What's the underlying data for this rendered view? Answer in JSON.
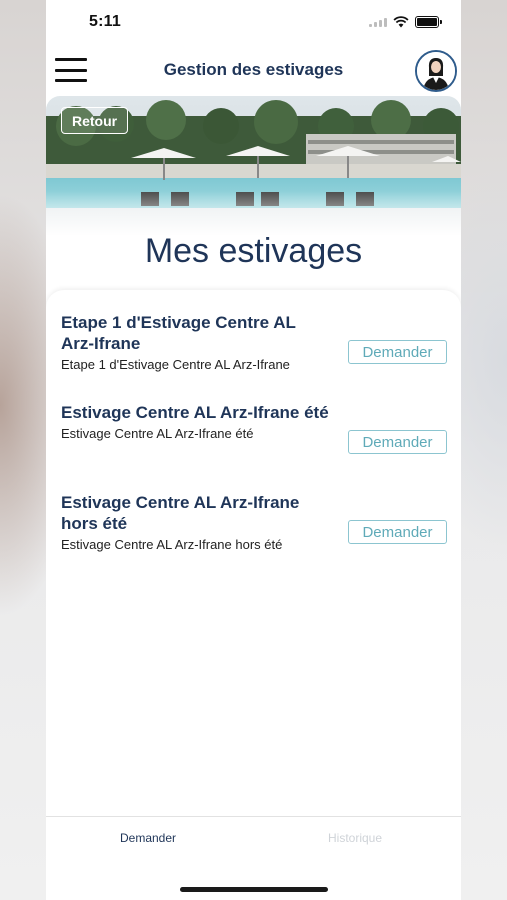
{
  "status": {
    "time": "5:11"
  },
  "header": {
    "title": "Gestion des estivages"
  },
  "hero": {
    "back_label": "Retour"
  },
  "page": {
    "title": "Mes estivages"
  },
  "items": [
    {
      "title": "Etape 1 d'Estivage Centre AL Arz-Ifrane",
      "subtitle": "Etape 1 d'Estivage Centre AL Arz-Ifrane",
      "button": "Demander"
    },
    {
      "title": "Estivage Centre AL Arz-Ifrane été",
      "subtitle": "Estivage Centre AL Arz-Ifrane été",
      "button": "Demander"
    },
    {
      "title": "Estivage Centre AL Arz-Ifrane hors été",
      "subtitle": "Estivage Centre AL Arz-Ifrane hors été",
      "button": "Demander"
    }
  ],
  "tabs": [
    {
      "label": "Demander",
      "active": true
    },
    {
      "label": "Historique",
      "active": false
    }
  ],
  "colors": {
    "primary": "#1f3558",
    "accent": "#5faab8",
    "avatar_border": "#2f5c8c"
  }
}
